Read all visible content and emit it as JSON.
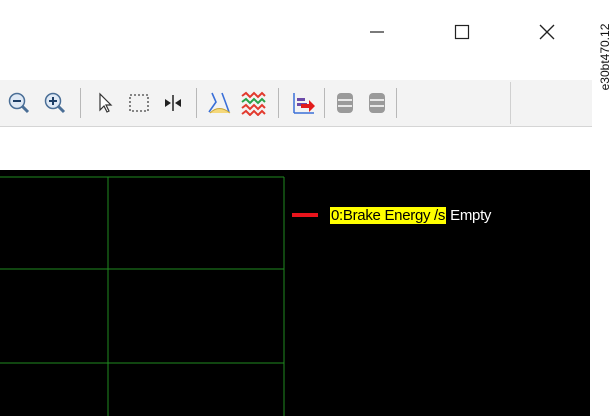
{
  "window": {
    "minimize_glyph": "—",
    "maximize_glyph": "☐",
    "close_glyph": "✕"
  },
  "watermark": "e30bt470.12",
  "toolbar": {
    "icons": [
      "zoom-out-icon",
      "zoom-in-icon",
      "pointer-icon",
      "select-rectangle-icon",
      "cursor-split-icon",
      "chart-style-icon",
      "chart-colors-icon",
      "export-data-icon",
      "database-icon",
      "database-alt-icon"
    ]
  },
  "plot": {
    "background": "#000000",
    "grid_color": "#1f8a1f",
    "legend": [
      {
        "label": "0:Brake Energy /s",
        "status": "Empty",
        "color": "#e8141c",
        "highlight": "#ffff00"
      }
    ]
  }
}
